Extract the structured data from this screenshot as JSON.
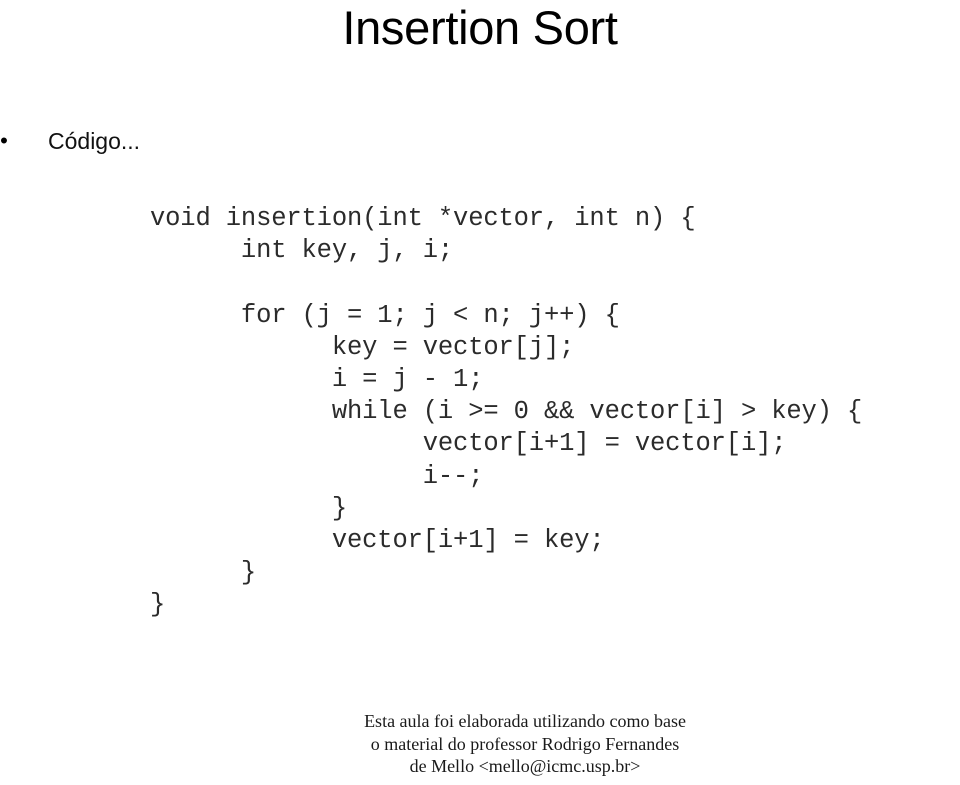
{
  "slide": {
    "title": "Insertion Sort",
    "background_color": "#ffffff",
    "text_color": "#000000"
  },
  "bullet": {
    "marker": "•",
    "text": "Código..."
  },
  "code": {
    "language": "c",
    "lines": [
      "void insertion(int *vector, int n) {",
      "      int key, j, i;",
      "",
      "      for (j = 1; j < n; j++) {",
      "            key = vector[j];",
      "            i = j - 1;",
      "            while (i >= 0 && vector[i] > key) {",
      "                  vector[i+1] = vector[i];",
      "                  i--;",
      "            }",
      "            vector[i+1] = key;",
      "      }",
      "}"
    ]
  },
  "footer": {
    "lines": [
      "Esta aula foi elaborada utilizando como base",
      "o material do professor Rodrigo Fernandes",
      "de Mello <mello@icmc.usp.br>"
    ]
  }
}
